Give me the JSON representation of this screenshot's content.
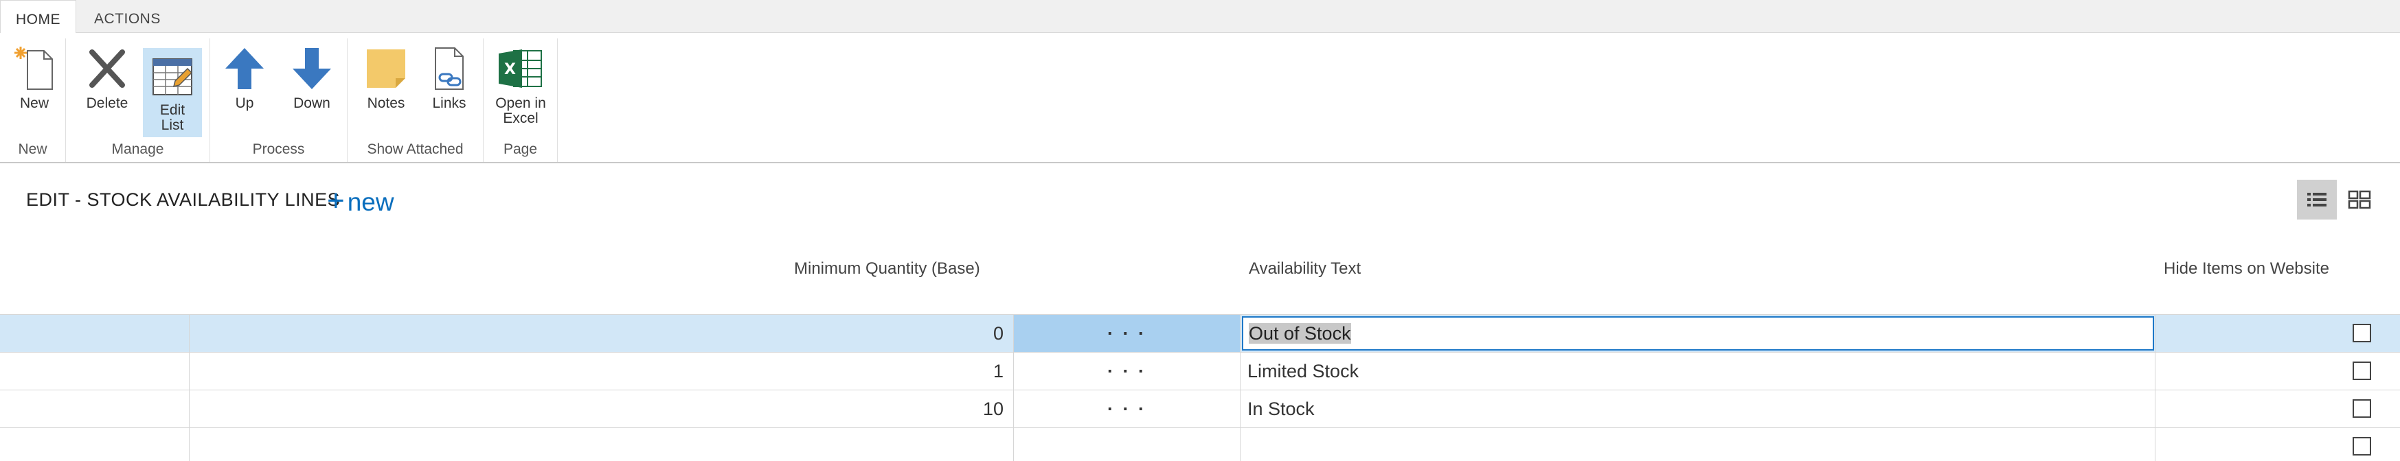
{
  "tabs": [
    {
      "label": "HOME",
      "active": true
    },
    {
      "label": "ACTIONS",
      "active": false
    }
  ],
  "ribbon": {
    "groups": [
      {
        "label": "New",
        "buttons": [
          {
            "label": "New",
            "icon": "new-document-icon"
          }
        ]
      },
      {
        "label": "Manage",
        "buttons": [
          {
            "label": "Delete",
            "icon": "delete-x-icon"
          },
          {
            "label": "Edit List",
            "icon": "edit-list-icon",
            "selected": true
          }
        ]
      },
      {
        "label": "Process",
        "buttons": [
          {
            "label": "Up",
            "icon": "arrow-up-icon"
          },
          {
            "label": "Down",
            "icon": "arrow-down-icon"
          }
        ]
      },
      {
        "label": "Show Attached",
        "buttons": [
          {
            "label": "Notes",
            "icon": "notes-icon"
          },
          {
            "label": "Links",
            "icon": "links-icon"
          }
        ]
      },
      {
        "label": "Page",
        "buttons": [
          {
            "label": "Open in Excel",
            "icon": "excel-icon"
          }
        ]
      }
    ]
  },
  "page": {
    "title": "EDIT - STOCK AVAILABILITY LINES",
    "new_label": "new",
    "new_symbol": "+"
  },
  "columns": {
    "min_qty": "Minimum Quantity (Base)",
    "availability_text": "Availability Text",
    "hide_items": "Hide Items on Website"
  },
  "rows": [
    {
      "min_qty": "0",
      "assist": "· · ·",
      "availability_text": "Out of Stock",
      "hide_items": false,
      "selected": true,
      "editing": true
    },
    {
      "min_qty": "1",
      "assist": "· · ·",
      "availability_text": "Limited Stock",
      "hide_items": false
    },
    {
      "min_qty": "10",
      "assist": "· · ·",
      "availability_text": "In Stock",
      "hide_items": false
    },
    {
      "min_qty": "",
      "assist": "",
      "availability_text": "",
      "hide_items": false
    }
  ],
  "colors": {
    "accent": "#0a6ebd",
    "selected_row": "#d2e7f7",
    "ribbon_selected": "#c9e3f6",
    "edit_border": "#1e78c8"
  }
}
